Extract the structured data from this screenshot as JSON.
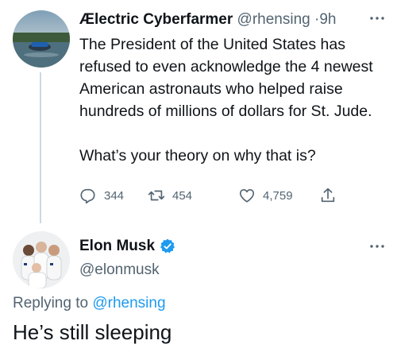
{
  "parent_tweet": {
    "display_name": "Ælectric Cyberfarmer",
    "handle": "@rhensing",
    "separator": "·",
    "time": "9h",
    "text_lines": [
      "The President of the United States has refused to even acknowledge the 4 newest American astronauts who helped raise hundreds of millions of dollars for St. Jude.",
      "What’s your theory on why that is?"
    ],
    "actions": {
      "reply_count": "344",
      "retweet_count": "454",
      "like_count": "4,759"
    }
  },
  "reply_tweet": {
    "display_name": "Elon Musk",
    "verified": true,
    "handle": "@elonmusk",
    "replying_prefix": "Replying to",
    "replying_to": "@rhensing",
    "text": "He’s still sleeping"
  },
  "colors": {
    "primary_text": "#0f1419",
    "secondary_text": "#536471",
    "accent_blue": "#1d9bf0",
    "thread_line": "#cfd9de"
  },
  "icons": {
    "reply": "reply-icon",
    "retweet": "retweet-icon",
    "like": "heart-icon",
    "share": "share-icon",
    "more": "more-icon",
    "verified": "verified-badge-icon"
  }
}
